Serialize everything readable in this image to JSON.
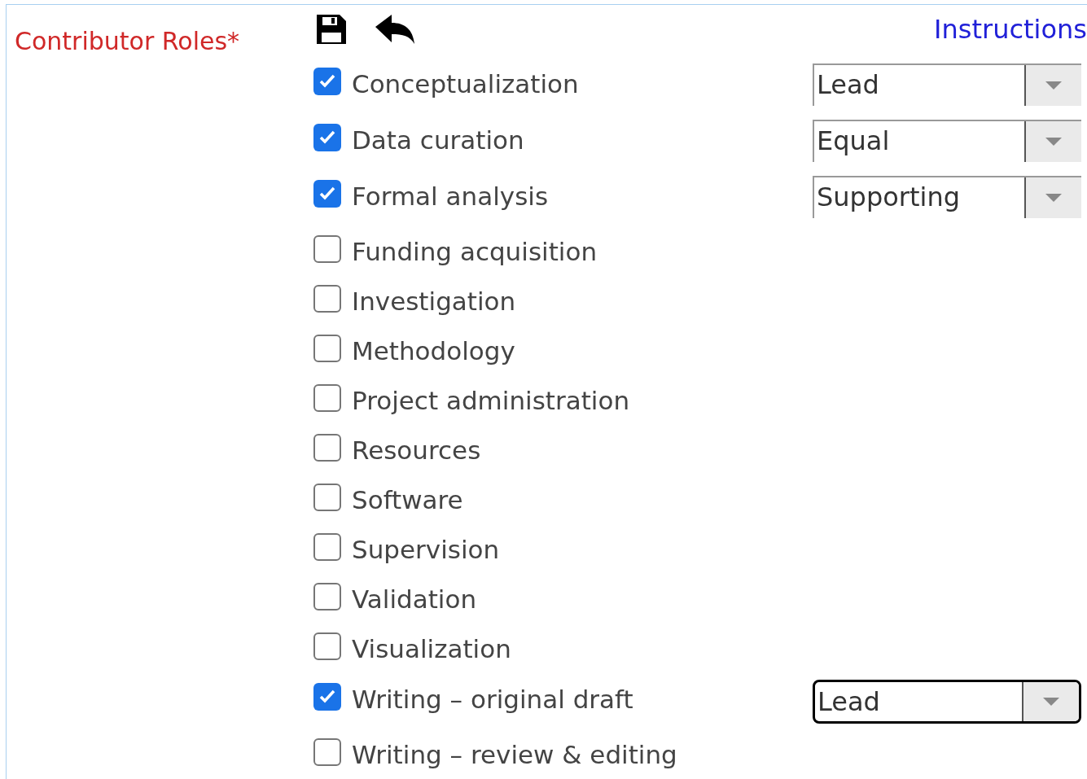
{
  "field_label": "Contributor Roles*",
  "instructions_link": "Instructions",
  "roles": [
    {
      "label": "Conceptualization",
      "checked": true,
      "contribution": {
        "value": "Lead",
        "focused": false
      }
    },
    {
      "label": "Data curation",
      "checked": true,
      "contribution": {
        "value": "Equal",
        "focused": false
      }
    },
    {
      "label": "Formal analysis",
      "checked": true,
      "contribution": {
        "value": "Supporting",
        "focused": false
      }
    },
    {
      "label": "Funding acquisition",
      "checked": false
    },
    {
      "label": "Investigation",
      "checked": false
    },
    {
      "label": "Methodology",
      "checked": false
    },
    {
      "label": "Project administration",
      "checked": false
    },
    {
      "label": "Resources",
      "checked": false
    },
    {
      "label": "Software",
      "checked": false
    },
    {
      "label": "Supervision",
      "checked": false
    },
    {
      "label": "Validation",
      "checked": false
    },
    {
      "label": "Visualization",
      "checked": false
    },
    {
      "label": "Writing – original draft",
      "checked": true,
      "contribution": {
        "value": "Lead",
        "focused": true
      }
    },
    {
      "label": "Writing – review & editing",
      "checked": false
    }
  ]
}
